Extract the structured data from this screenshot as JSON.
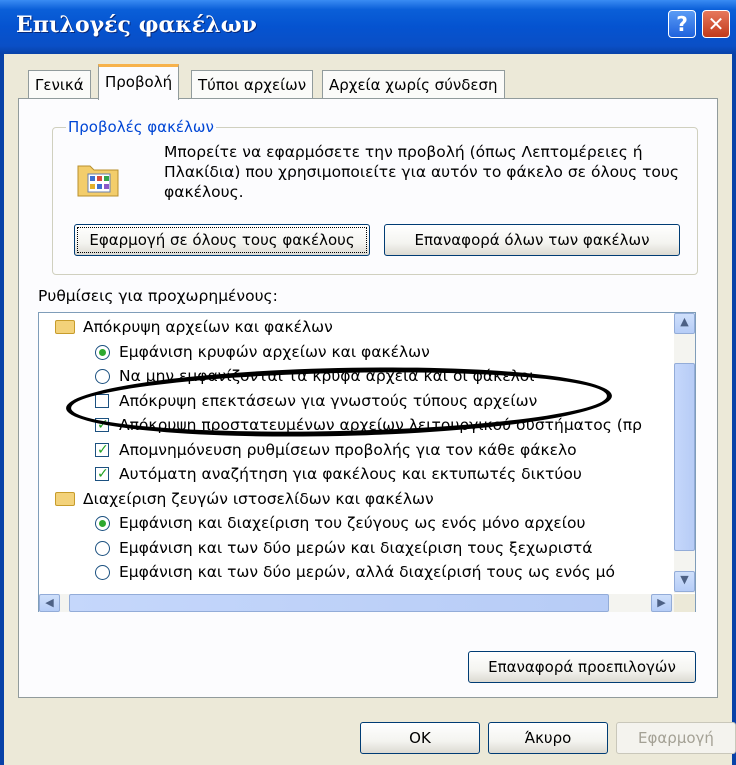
{
  "window": {
    "title": "Επιλογές φακέλων",
    "help_glyph": "?",
    "close_glyph": "✕"
  },
  "tabs": [
    {
      "label": "Γενικά"
    },
    {
      "label": "Προβολή"
    },
    {
      "label": "Τύποι αρχείων"
    },
    {
      "label": "Αρχεία χωρίς σύνδεση"
    }
  ],
  "folder_views": {
    "group_label": "Προβολές φακέλων",
    "description": "Μπορείτε να εφαρμόσετε την προβολή (όπως Λεπτομέρειες ή Πλακίδια) που χρησιμοποιείτε για αυτόν το φάκελο σε όλους τους φακέλους.",
    "apply_all_label": "Εφαρμογή σε όλους τους φακέλους",
    "reset_all_label": "Επαναφορά όλων των φακέλων"
  },
  "advanced": {
    "label": "Ρυθμίσεις για προχωρημένους:",
    "items": [
      {
        "type": "folder",
        "text": "Απόκρυψη αρχείων και φακέλων"
      },
      {
        "type": "radio",
        "checked": true,
        "text": "Εμφάνιση κρυφών αρχείων και φακέλων"
      },
      {
        "type": "radio",
        "checked": false,
        "text": "Να μην εμφανίζονται τα κρυφά αρχεία και οι φάκελοι"
      },
      {
        "type": "checkbox",
        "checked": false,
        "text": "Απόκρυψη επεκτάσεων για γνωστούς τύπους αρχείων"
      },
      {
        "type": "checkbox",
        "checked": true,
        "text": "Απόκρυψη προστατευμένων αρχείων λειτουργικού συστήματος (πρ"
      },
      {
        "type": "checkbox",
        "checked": true,
        "text": "Απομνημόνευση ρυθμίσεων προβολής για τον κάθε φάκελο"
      },
      {
        "type": "checkbox",
        "checked": true,
        "text": "Αυτόματη αναζήτηση για φακέλους και εκτυπωτές δικτύου"
      },
      {
        "type": "folder",
        "text": "Διαχείριση ζευγών ιστοσελίδων και φακέλων"
      },
      {
        "type": "radio",
        "checked": true,
        "text": "Εμφάνιση και διαχείριση του ζεύγους ως ενός μόνο αρχείου"
      },
      {
        "type": "radio",
        "checked": false,
        "text": "Εμφάνιση και των δύο μερών και διαχείριση τους ξεχωριστά"
      },
      {
        "type": "radio",
        "checked": false,
        "text": "Εμφάνιση και των δύο μερών, αλλά διαχείρισή τους ως ενός μό"
      }
    ]
  },
  "restore_defaults_label": "Επαναφορά προεπιλογών",
  "footer": {
    "ok_label": "OK",
    "cancel_label": "Άκυρο",
    "apply_label": "Εφαρμογή"
  },
  "colors": {
    "title_bar": "#0553d0",
    "group_label": "#0046d5",
    "annotation": "#000000"
  }
}
